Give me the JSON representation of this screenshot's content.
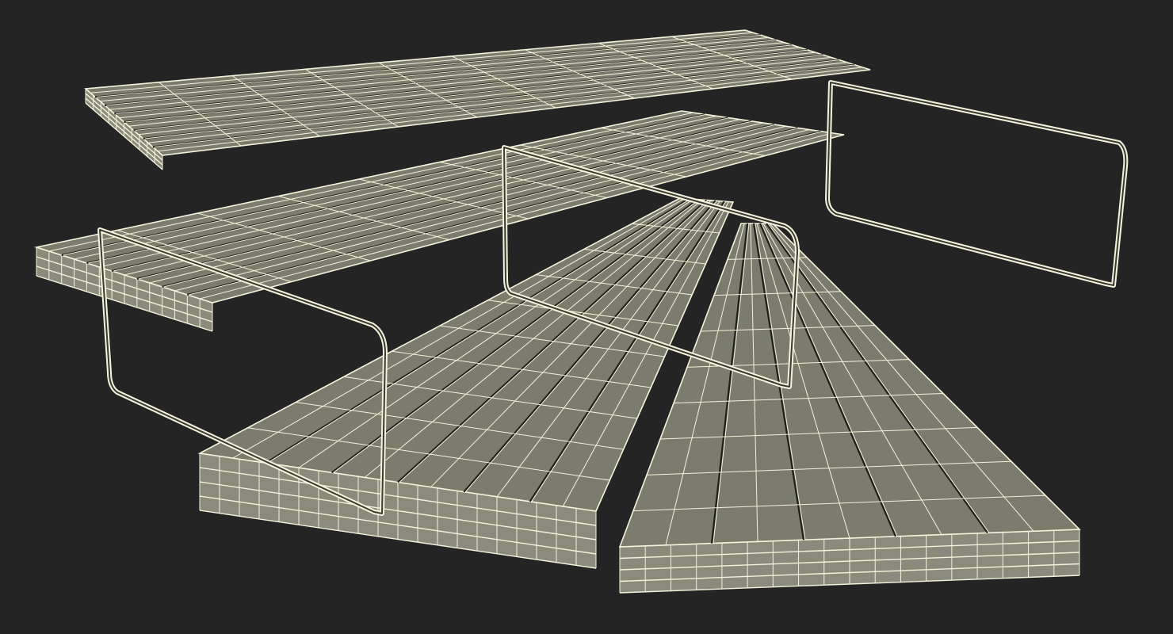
{
  "scene": {
    "background_color": "#242424",
    "surface_color": "#7b7c6d",
    "side_color": "#8a8b7c",
    "wire_color": "#f4f3dc",
    "wire_dark_color": "#1e1e1a",
    "objects": [
      "lumber-stack-bottom-right",
      "lumber-stack-middle",
      "lumber-stack-left",
      "lumber-stack-top",
      "strap-left",
      "strap-middle",
      "strap-right"
    ]
  }
}
